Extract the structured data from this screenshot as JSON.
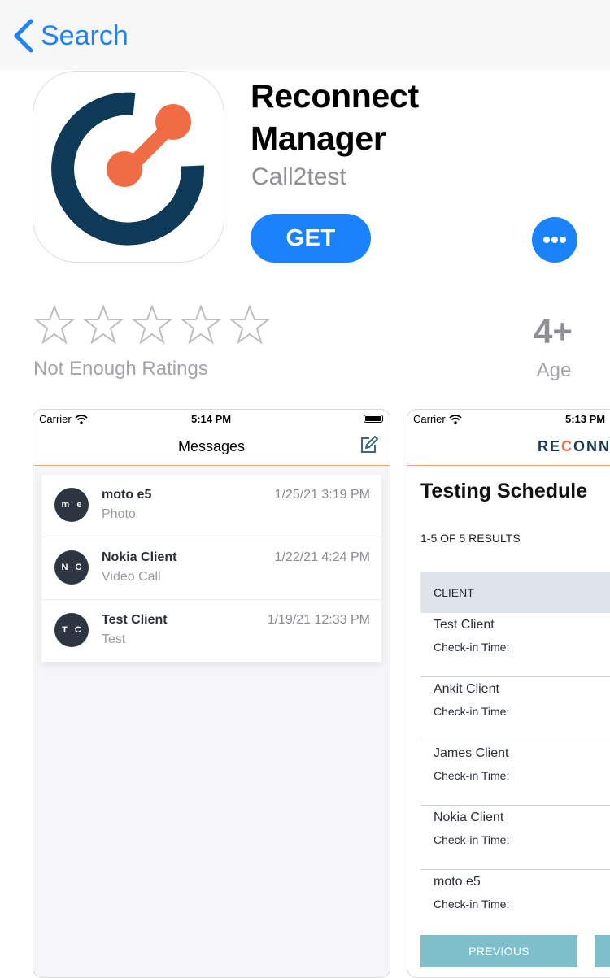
{
  "nav": {
    "back_label": "Search"
  },
  "app": {
    "name_line1": "Reconnect",
    "name_line2": "Manager",
    "developer": "Call2test",
    "get_label": "GET"
  },
  "ratings": {
    "stars": 0,
    "label": "Not Enough Ratings"
  },
  "age": {
    "value": "4+",
    "label": "Age"
  },
  "colors": {
    "accent": "#1a82fb",
    "icon_navy": "#0f3a57",
    "icon_orange": "#ef6c44"
  },
  "screenshot1": {
    "carrier": "Carrier",
    "time": "5:14 PM",
    "title": "Messages",
    "messages": [
      {
        "initials": "m e",
        "name": "moto e5",
        "preview": "Photo",
        "date": "1/25/21 3:19 PM"
      },
      {
        "initials": "N C",
        "name": "Nokia Client",
        "preview": "Video Call",
        "date": "1/22/21 4:24 PM"
      },
      {
        "initials": "T C",
        "name": "Test Client",
        "preview": "Test",
        "date": "1/19/21 12:33 PM"
      }
    ]
  },
  "screenshot2": {
    "carrier": "Carrier",
    "time": "5:13 PM",
    "logo_pre": "RE",
    "logo_o": "C",
    "logo_post": "ONNE",
    "title": "Testing Schedule",
    "results": "1-5 OF 5 RESULTS",
    "column": "CLIENT",
    "rows": [
      {
        "name": "Test Client",
        "checkin": "Check-in Time:"
      },
      {
        "name": "Ankit Client",
        "checkin": "Check-in Time:"
      },
      {
        "name": "James Client",
        "checkin": "Check-in Time:"
      },
      {
        "name": "Nokia Client",
        "checkin": "Check-in Time:"
      },
      {
        "name": "moto e5",
        "checkin": "Check-in Time:"
      }
    ],
    "previous_label": "PREVIOUS"
  }
}
